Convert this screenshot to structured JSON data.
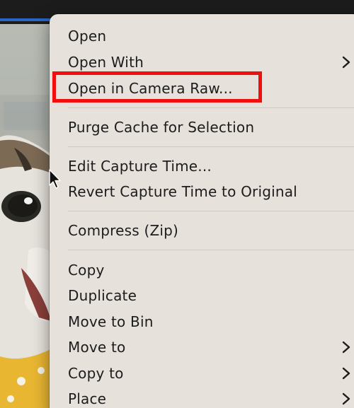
{
  "menu": {
    "items": [
      {
        "label": "Open"
      },
      {
        "label": "Open With",
        "submenu": true
      },
      {
        "label": "Open in Camera Raw...",
        "highlighted": true
      },
      {
        "label": "Purge Cache for Selection"
      },
      {
        "label": "Edit Capture Time..."
      },
      {
        "label": "Revert Capture Time to Original"
      },
      {
        "label": "Compress (Zip)"
      },
      {
        "label": "Copy"
      },
      {
        "label": "Duplicate"
      },
      {
        "label": "Move to Bin"
      },
      {
        "label": "Move to",
        "submenu": true
      },
      {
        "label": "Copy to",
        "submenu": true
      },
      {
        "label": "Place",
        "submenu": true
      }
    ]
  },
  "annotation": {
    "highlight_color": "#f00e0e"
  },
  "icons": {
    "submenu": "chevron-right-icon",
    "pointer": "mouse-cursor-icon"
  }
}
